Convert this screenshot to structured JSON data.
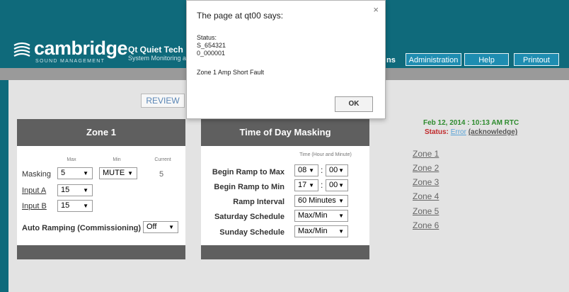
{
  "header": {
    "logo_word": "cambridge",
    "logo_sub": "SOUND MANAGEMENT",
    "product": "Qt Quiet Tech",
    "product_sub": "System Monitoring a",
    "nav_partial": "ns",
    "nav": [
      "Administration",
      "Help",
      "Printout"
    ]
  },
  "review_label": "REVIEW",
  "zone1": {
    "title": "Zone 1",
    "col_max": "Max",
    "col_min": "Min",
    "col_current": "Current",
    "masking_label": "Masking",
    "masking_max": "5",
    "masking_min": "MUTE",
    "masking_current": "5",
    "input_a_label": "Input A",
    "input_a_value": "15",
    "input_b_label": "Input B",
    "input_b_value": "15",
    "auto_label": "Auto Ramping (Commissioning)",
    "auto_value": "Off"
  },
  "tod": {
    "title": "Time of Day Masking",
    "col_header": "Time (Hour and Minute)",
    "begin_max_label": "Begin Ramp to Max",
    "begin_max_hour": "08",
    "begin_max_min": "00",
    "begin_min_label": "Begin Ramp to Min",
    "begin_min_hour": "17",
    "begin_min_min": "00",
    "interval_label": "Ramp Interval",
    "interval_value": "60 Minutes",
    "saturday_label": "Saturday Schedule",
    "saturday_value": "Max/Min",
    "sunday_label": "Sunday Schedule",
    "sunday_value": "Max/Min"
  },
  "side": {
    "rtc": "Feb 12, 2014 : 10:13 AM RTC",
    "status_key": "Status:",
    "status_error": "Error",
    "status_ack": "(acknowledge)",
    "zones": [
      "Zone 1",
      "Zone 2",
      "Zone 3",
      "Zone 4",
      "Zone 5",
      "Zone 6"
    ]
  },
  "dialog": {
    "title": "The page at qt00 says:",
    "close": "×",
    "lines": [
      "Status:",
      "S_654321",
      "0_000001",
      "Zone 1 Amp Short Fault"
    ],
    "ok": "OK"
  },
  "colors": {
    "background": "#0f6a7b",
    "nav": "#1e8db1",
    "panel_head": "#5f5f5f",
    "rtc": "#2e8b2e",
    "status": "#c0282a"
  },
  "icons": {
    "logo": "sound-waves-icon",
    "dropdown": "chevron-down-icon",
    "close": "close-icon"
  }
}
